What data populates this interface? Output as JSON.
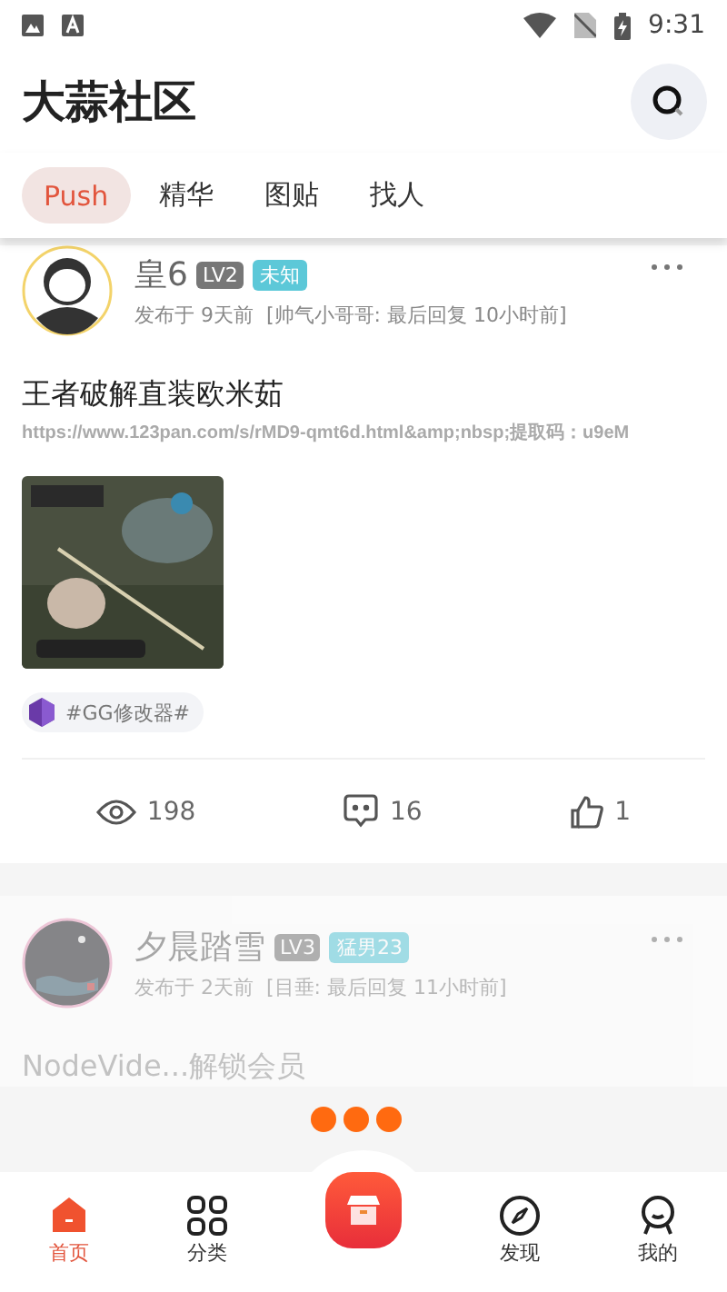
{
  "status_bar": {
    "time": "9:31"
  },
  "header": {
    "title": "大蒜社区"
  },
  "tabs": [
    {
      "label": "Push",
      "selected": true
    },
    {
      "label": "精华",
      "selected": false
    },
    {
      "label": "图贴",
      "selected": false
    },
    {
      "label": "找人",
      "selected": false
    }
  ],
  "posts": [
    {
      "author": "皇6",
      "level": "LV2",
      "tag": "未知",
      "meta": "发布于 9天前",
      "reply": "[帅气小哥哥: 最后回复 10小时前]",
      "title": "王者破解直装欧米茹",
      "body": "https://www.123pan.com/s/rMD9-qmt6d.html&amp;nbsp;提取码：u9eM",
      "topic": "#GG修改器#",
      "views": "198",
      "comments": "16",
      "likes": "1",
      "faded": false
    },
    {
      "author": "夕晨踏雪",
      "level": "LV3",
      "tag": "猛男23",
      "meta": "发布于 2天前",
      "reply": "[目垂: 最后回复 11小时前]",
      "title": "NodeVide...解锁会员",
      "faded": true
    }
  ],
  "nav": [
    {
      "label": "首页",
      "selected": true,
      "kind": "home"
    },
    {
      "label": "分类",
      "selected": false,
      "kind": "grid"
    },
    {
      "kind": "center",
      "selected": false
    },
    {
      "label": "发现",
      "selected": false,
      "kind": "compass"
    },
    {
      "label": "我的",
      "selected": false,
      "kind": "person"
    }
  ]
}
